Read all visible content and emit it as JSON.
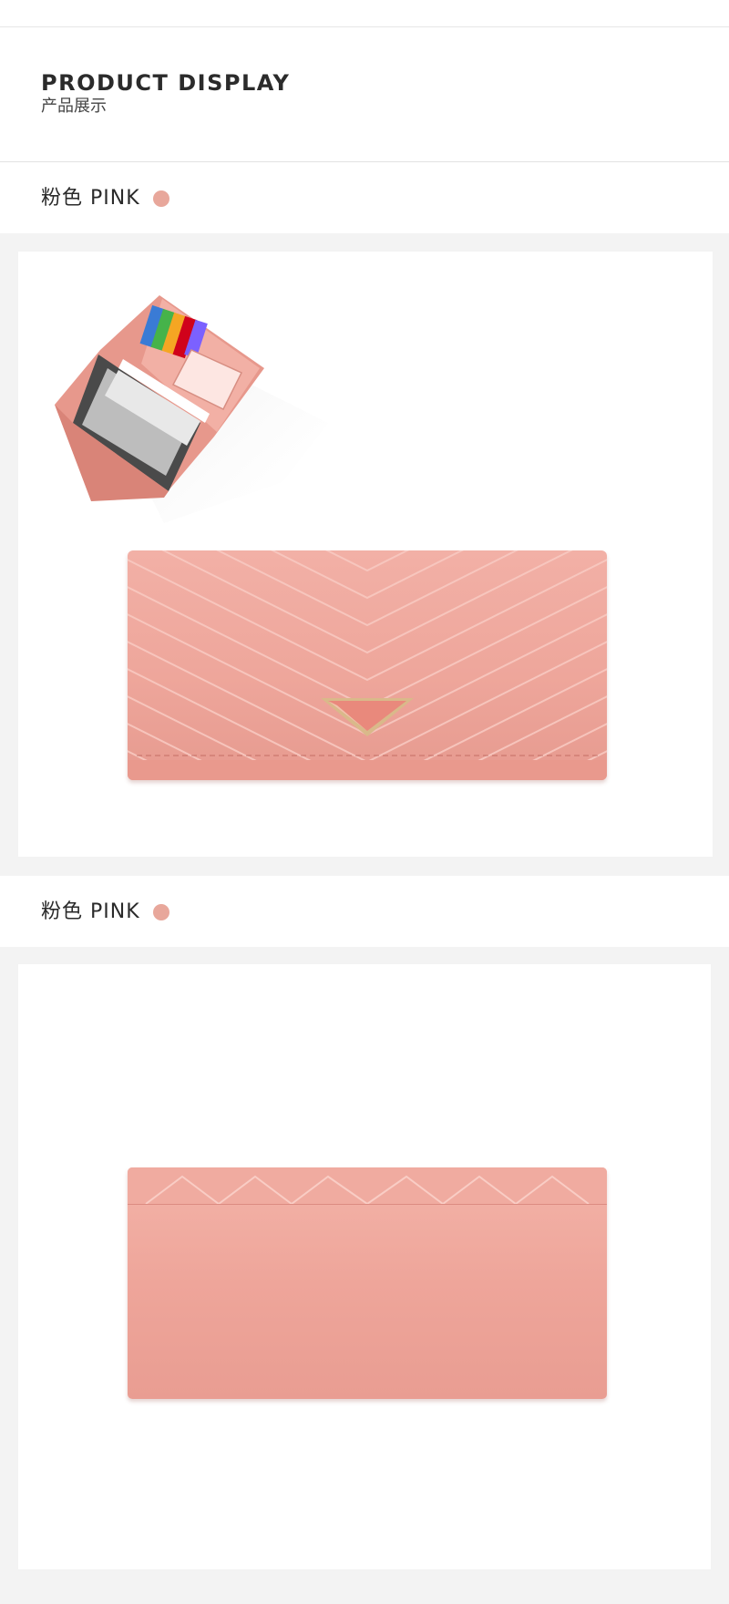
{
  "header": {
    "title": "PRODUCT DISPLAY",
    "subtitle": "产品展示"
  },
  "variants": [
    {
      "label": "粉色 PINK",
      "swatch_color": "#e8a79b"
    },
    {
      "label": "粉色 PINK",
      "swatch_color": "#e8a79b"
    }
  ],
  "colors": {
    "page_background": "#ffffff",
    "panel_background": "#f3f3f3",
    "wallet_pink": "#eea69b",
    "clasp_gold": "#d9b98a"
  }
}
